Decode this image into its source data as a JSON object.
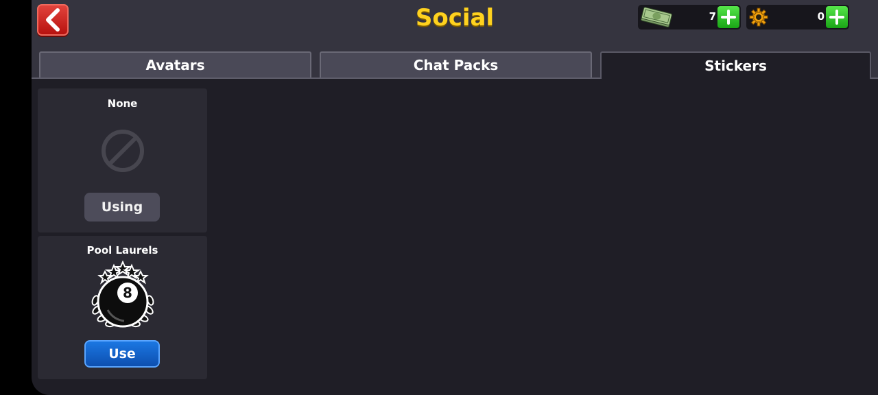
{
  "header": {
    "title": "Social"
  },
  "currency": {
    "cash": {
      "count": "7"
    },
    "coins": {
      "count": "0"
    }
  },
  "tabs": [
    {
      "label": "Avatars",
      "active": false
    },
    {
      "label": "Chat Packs",
      "active": false
    },
    {
      "label": "Stickers",
      "active": true
    }
  ],
  "stickers": [
    {
      "name": "None",
      "button": "Using",
      "icon": "none-prohibited-icon"
    },
    {
      "name": "Pool Laurels",
      "button": "Use",
      "icon": "eight-ball-laurels-icon"
    }
  ],
  "colors": {
    "title": "#ffd21f",
    "back_button": "#c8231e",
    "plus_button": "#33c42a",
    "use_button": "#1466cc",
    "background": "#1f1e26"
  }
}
